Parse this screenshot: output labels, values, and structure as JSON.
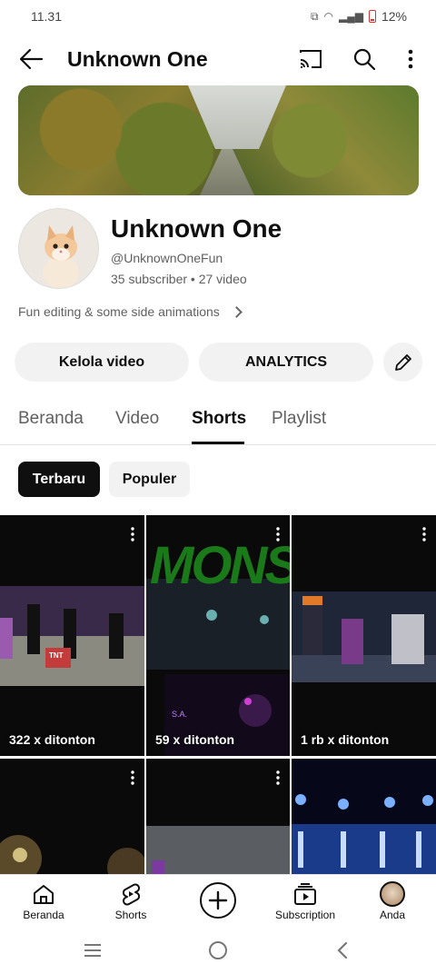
{
  "status_bar": {
    "time": "11.31",
    "battery": "12%"
  },
  "header": {
    "title": "Unknown One"
  },
  "channel": {
    "name": "Unknown One",
    "handle": "@UnknownOneFun",
    "stats": "35 subscriber • 27 video",
    "description": "Fun editing & some side animations"
  },
  "actions": {
    "manage": "Kelola video",
    "analytics": "ANALYTICS"
  },
  "tabs": [
    {
      "label": "Beranda"
    },
    {
      "label": "Video"
    },
    {
      "label": "Shorts"
    },
    {
      "label": "Playlist"
    }
  ],
  "active_tab": "Shorts",
  "filters": [
    {
      "label": "Terbaru"
    },
    {
      "label": "Populer"
    }
  ],
  "shorts": [
    {
      "views": "322 x ditonton",
      "thumb_text": "TNT"
    },
    {
      "views": "59 x ditonton",
      "thumb_text": "MONSTE",
      "badge": "S.A."
    },
    {
      "views": "1 rb x ditonton"
    },
    {
      "views": ""
    },
    {
      "views": ""
    },
    {
      "views": ""
    }
  ],
  "bottom_nav": [
    {
      "label": "Beranda",
      "icon": "home-icon"
    },
    {
      "label": "Shorts",
      "icon": "shorts-icon"
    },
    {
      "label": "",
      "icon": "create-icon"
    },
    {
      "label": "Subscription",
      "icon": "subscriptions-icon"
    },
    {
      "label": "Anda",
      "icon": "avatar-icon"
    }
  ],
  "colors": {
    "text": "#0f0f0f",
    "secondary": "#606060",
    "chip_bg": "#f2f2f2"
  }
}
